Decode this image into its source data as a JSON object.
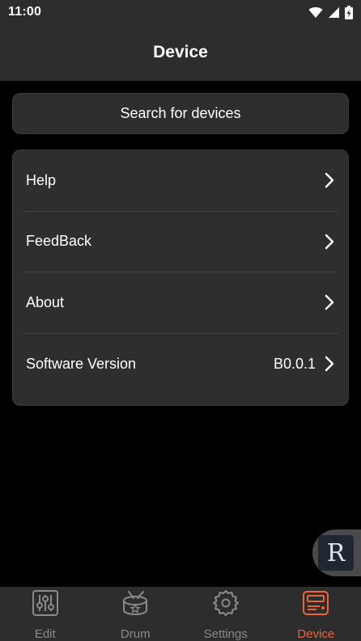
{
  "status_bar": {
    "time": "11:00",
    "icons": [
      "wifi-icon",
      "signal-icon",
      "battery-icon"
    ]
  },
  "header": {
    "title": "Device"
  },
  "search": {
    "label": "Search for devices"
  },
  "menu": {
    "items": [
      {
        "label": "Help",
        "value": ""
      },
      {
        "label": "FeedBack",
        "value": ""
      },
      {
        "label": "About",
        "value": ""
      },
      {
        "label": "Software Version",
        "value": "B0.0.1"
      }
    ]
  },
  "floating_button": {
    "letter": "R"
  },
  "tabs": [
    {
      "label": "Edit",
      "icon": "sliders-icon",
      "active": false
    },
    {
      "label": "Drum",
      "icon": "drum-icon",
      "active": false
    },
    {
      "label": "Settings",
      "icon": "gear-icon",
      "active": false
    },
    {
      "label": "Device",
      "icon": "device-icon",
      "active": true
    }
  ],
  "colors": {
    "accent": "#e8663d",
    "inactive": "#8a8a8a",
    "bar_bg": "#2d2d2d",
    "card_bg": "#2e2e2e",
    "page_bg": "#000000"
  }
}
